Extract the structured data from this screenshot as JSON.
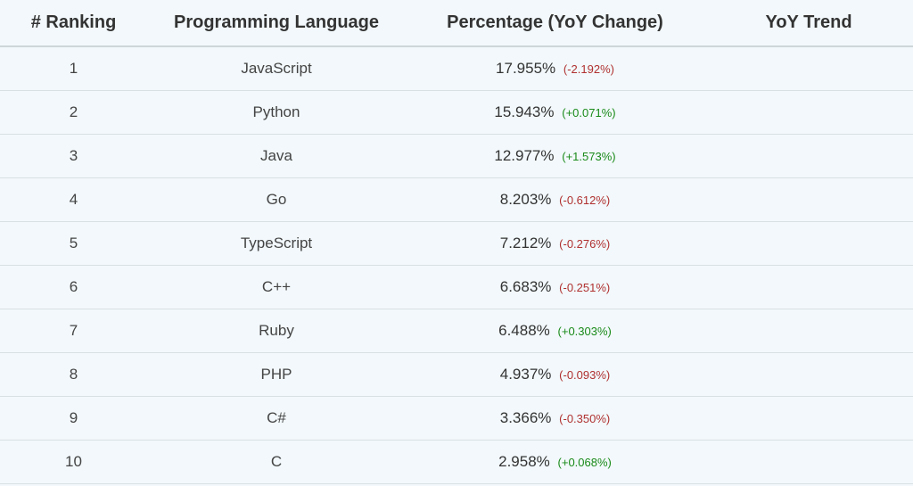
{
  "columns": {
    "ranking": "# Ranking",
    "language": "Programming Language",
    "percentage": "Percentage (YoY Change)",
    "trend": "YoY Trend"
  },
  "rows": [
    {
      "rank": "1",
      "language": "JavaScript",
      "percentage": "17.955%",
      "yoy": "(-2.192%)",
      "dir": "neg"
    },
    {
      "rank": "2",
      "language": "Python",
      "percentage": "15.943%",
      "yoy": "(+0.071%)",
      "dir": "pos"
    },
    {
      "rank": "3",
      "language": "Java",
      "percentage": "12.977%",
      "yoy": "(+1.573%)",
      "dir": "pos"
    },
    {
      "rank": "4",
      "language": "Go",
      "percentage": "8.203%",
      "yoy": "(-0.612%)",
      "dir": "neg"
    },
    {
      "rank": "5",
      "language": "TypeScript",
      "percentage": "7.212%",
      "yoy": "(-0.276%)",
      "dir": "neg"
    },
    {
      "rank": "6",
      "language": "C++",
      "percentage": "6.683%",
      "yoy": "(-0.251%)",
      "dir": "neg"
    },
    {
      "rank": "7",
      "language": "Ruby",
      "percentage": "6.488%",
      "yoy": "(+0.303%)",
      "dir": "pos"
    },
    {
      "rank": "8",
      "language": "PHP",
      "percentage": "4.937%",
      "yoy": "(-0.093%)",
      "dir": "neg"
    },
    {
      "rank": "9",
      "language": "C#",
      "percentage": "3.366%",
      "yoy": "(-0.350%)",
      "dir": "neg"
    },
    {
      "rank": "10",
      "language": "C",
      "percentage": "2.958%",
      "yoy": "(+0.068%)",
      "dir": "pos"
    }
  ]
}
